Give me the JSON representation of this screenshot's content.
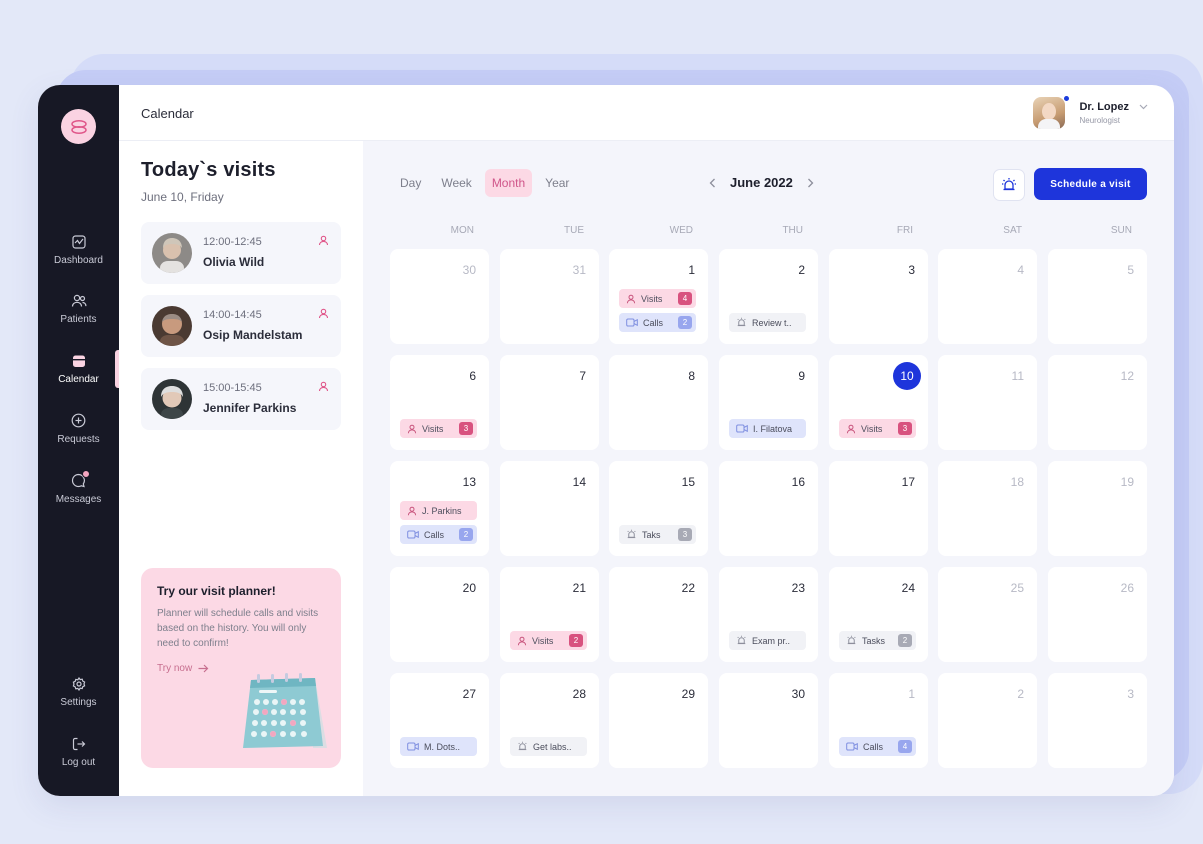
{
  "header": {
    "title": "Calendar"
  },
  "profile": {
    "name": "Dr. Lopez",
    "role": "Neurologist"
  },
  "sidebar": {
    "items": [
      {
        "label": "Dashboard",
        "icon": "dashboard-icon"
      },
      {
        "label": "Patients",
        "icon": "patients-icon"
      },
      {
        "label": "Calendar",
        "icon": "calendar-icon",
        "active": true
      },
      {
        "label": "Requests",
        "icon": "plus-circle-icon"
      },
      {
        "label": "Messages",
        "icon": "message-icon"
      },
      {
        "label": "Settings",
        "icon": "gear-icon"
      },
      {
        "label": "Log out",
        "icon": "logout-icon"
      }
    ]
  },
  "today": {
    "title": "Today`s visits",
    "date": "June 10, Friday",
    "visits": [
      {
        "time": "12:00-12:45",
        "name": "Olivia Wild"
      },
      {
        "time": "14:00-14:45",
        "name": "Osip Mandelstam"
      },
      {
        "time": "15:00-15:45",
        "name": "Jennifer Parkins"
      }
    ]
  },
  "promo": {
    "title": "Try our visit planner!",
    "text": "Planner will schedule calls and visits based on the history.  You will only need to confirm!",
    "link": "Try now"
  },
  "calendar": {
    "views": [
      "Day",
      "Week",
      "Month",
      "Year"
    ],
    "active_view": "Month",
    "month": "June 2022",
    "schedule_button": "Schedule a visit",
    "weekdays": [
      "MON",
      "TUE",
      "WED",
      "THU",
      "FRI",
      "SAT",
      "SUN"
    ],
    "days": [
      {
        "n": "30",
        "muted": true,
        "events": []
      },
      {
        "n": "31",
        "muted": true,
        "events": []
      },
      {
        "n": "1",
        "events": [
          {
            "type": "pink",
            "icon": "user",
            "label": "Visits",
            "count": "4"
          },
          {
            "type": "blue",
            "icon": "video",
            "label": "Calls",
            "count": "2"
          }
        ]
      },
      {
        "n": "2",
        "events": [
          {
            "type": "gray",
            "icon": "alarm",
            "label": "Review t.."
          }
        ]
      },
      {
        "n": "3",
        "events": []
      },
      {
        "n": "4",
        "weekend": true,
        "events": []
      },
      {
        "n": "5",
        "weekend": true,
        "events": []
      },
      {
        "n": "6",
        "events": [
          {
            "type": "pink",
            "icon": "user",
            "label": "Visits",
            "count": "3"
          }
        ]
      },
      {
        "n": "7",
        "events": []
      },
      {
        "n": "8",
        "events": []
      },
      {
        "n": "9",
        "events": [
          {
            "type": "blue",
            "icon": "video",
            "label": "I. Filatova"
          }
        ]
      },
      {
        "n": "10",
        "today": true,
        "events": [
          {
            "type": "pink",
            "icon": "user",
            "label": "Visits",
            "count": "3"
          }
        ]
      },
      {
        "n": "11",
        "weekend": true,
        "events": []
      },
      {
        "n": "12",
        "weekend": true,
        "events": []
      },
      {
        "n": "13",
        "events": [
          {
            "type": "pink",
            "icon": "user",
            "label": "J. Parkins"
          },
          {
            "type": "blue",
            "icon": "video",
            "label": "Calls",
            "count": "2"
          }
        ]
      },
      {
        "n": "14",
        "events": []
      },
      {
        "n": "15",
        "events": [
          {
            "type": "gray",
            "icon": "alarm",
            "label": "Taks",
            "count": "3"
          }
        ]
      },
      {
        "n": "16",
        "events": []
      },
      {
        "n": "17",
        "events": []
      },
      {
        "n": "18",
        "weekend": true,
        "events": []
      },
      {
        "n": "19",
        "weekend": true,
        "events": []
      },
      {
        "n": "20",
        "events": []
      },
      {
        "n": "21",
        "events": [
          {
            "type": "pink",
            "icon": "user",
            "label": "Visits",
            "count": "2"
          }
        ]
      },
      {
        "n": "22",
        "events": []
      },
      {
        "n": "23",
        "events": [
          {
            "type": "gray",
            "icon": "alarm",
            "label": "Exam pr.."
          }
        ]
      },
      {
        "n": "24",
        "events": [
          {
            "type": "gray",
            "icon": "alarm",
            "label": "Tasks",
            "count": "2"
          }
        ]
      },
      {
        "n": "25",
        "weekend": true,
        "events": []
      },
      {
        "n": "26",
        "weekend": true,
        "events": []
      },
      {
        "n": "27",
        "events": [
          {
            "type": "blue",
            "icon": "video",
            "label": "M.  Dots.."
          }
        ]
      },
      {
        "n": "28",
        "events": [
          {
            "type": "gray",
            "icon": "alarm",
            "label": "Get labs.."
          }
        ]
      },
      {
        "n": "29",
        "events": []
      },
      {
        "n": "30",
        "events": []
      },
      {
        "n": "1",
        "muted": true,
        "events": [
          {
            "type": "blue",
            "icon": "video",
            "label": "Calls",
            "count": "4"
          }
        ]
      },
      {
        "n": "2",
        "muted": true,
        "events": []
      },
      {
        "n": "3",
        "muted": true,
        "events": []
      }
    ]
  },
  "colors": {
    "accent": "#1e35db",
    "pink": "#fcd9e5",
    "sidebar": "#171825"
  }
}
